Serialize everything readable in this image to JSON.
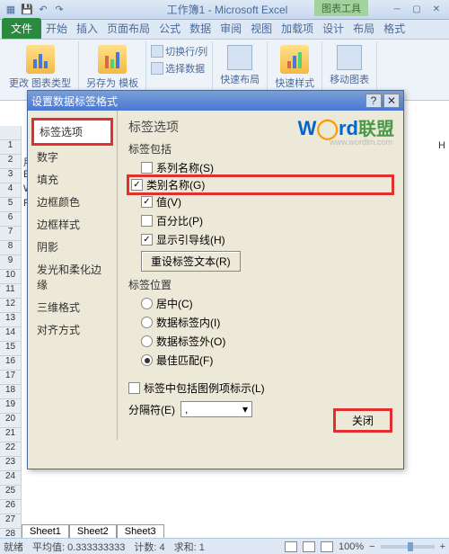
{
  "titlebar": {
    "doc": "工作簿1 - Microsoft Excel",
    "context": "图表工具"
  },
  "tabs": {
    "file": "文件",
    "t": [
      "开始",
      "插入",
      "页面布局",
      "公式",
      "数据",
      "审阅",
      "视图",
      "加载项",
      "设计",
      "布局",
      "格式"
    ]
  },
  "ribbon": {
    "change_type": "更改\n图表类型",
    "save_as": "另存为\n模板",
    "switch": "切换行/列",
    "select": "选择数据",
    "quick_layout": "快速布局",
    "quick_style": "快速样式",
    "move": "移动图表"
  },
  "dialog": {
    "title": "设置数据标签格式",
    "side": [
      "标签选项",
      "数字",
      "填充",
      "边框颜色",
      "边框样式",
      "阴影",
      "发光和柔化边缘",
      "三维格式",
      "对齐方式"
    ],
    "heading": "标签选项",
    "include": "标签包括",
    "opts": {
      "series": "系列名称(S)",
      "category": "类别名称(G)",
      "value": "值(V)",
      "percent": "百分比(P)",
      "leader": "显示引导线(H)"
    },
    "reset": "重设标签文本(R)",
    "pos": "标签位置",
    "posopts": {
      "center": "居中(C)",
      "inside": "数据标签内(I)",
      "outside": "数据标签外(O)",
      "bestfit": "最佳匹配(F)"
    },
    "legend_key": "标签中包括图例项标示(L)",
    "sep_label": "分隔符(E)",
    "sep_val": ",",
    "close": "关闭"
  },
  "cells": [
    "用",
    "Exc",
    "Wor",
    "PPT"
  ],
  "col": "H",
  "sheets": [
    "Sheet1",
    "Sheet2",
    "Sheet3"
  ],
  "status": {
    "ready": "就绪",
    "avg": "平均值: 0.333333333",
    "count": "计数: 4",
    "sum": "求和: 1",
    "zoom": "100%"
  }
}
